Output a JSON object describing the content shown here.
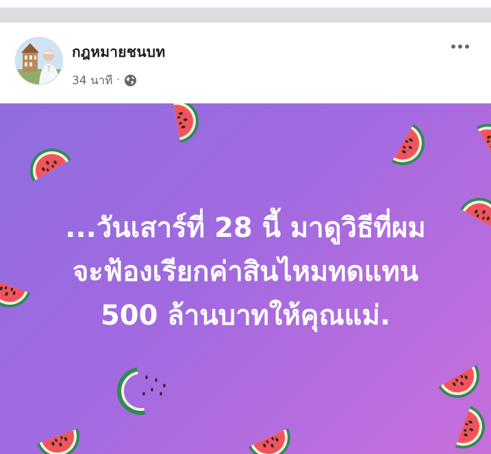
{
  "post": {
    "author": "กฎหมายชนบท",
    "timestamp": "34 นาที",
    "separator": "·",
    "privacy_icon": "globe-icon",
    "more_icon": "more-options-icon",
    "text_lines": [
      "...วันเสาร์ที่ 28 นี้ มาดูวิธีที่ผม",
      "จะฟ้องเรียกค่าสินไหมทดแทน",
      "500 ล้านบาทให้คุณแม่."
    ],
    "background_icon": "watermelon-slice-icon"
  },
  "colors": {
    "background_start": "#8f6ce0",
    "background_end": "#c86fdc",
    "text": "#ffffff",
    "author_text": "#1c1e21",
    "meta_text": "#65676b"
  }
}
